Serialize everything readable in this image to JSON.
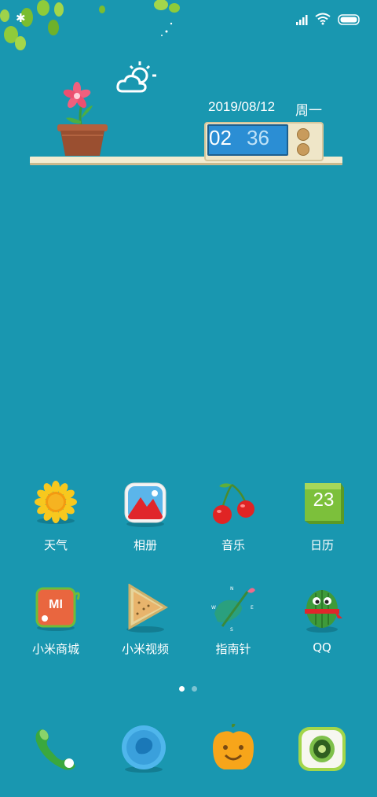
{
  "widget": {
    "date": "2019/08/12",
    "weekday": "周一",
    "clock_hour": "02",
    "clock_minute": "36"
  },
  "apps": [
    {
      "label": "天气",
      "icon": "sunflower-icon"
    },
    {
      "label": "相册",
      "icon": "gallery-icon"
    },
    {
      "label": "音乐",
      "icon": "cherry-icon"
    },
    {
      "label": "日历",
      "icon": "calendar-icon",
      "badge_text": "23"
    },
    {
      "label": "小米商城",
      "icon": "mi-store-icon",
      "badge_text": "MI"
    },
    {
      "label": "小米视频",
      "icon": "video-icon"
    },
    {
      "label": "指南针",
      "icon": "compass-icon"
    },
    {
      "label": "QQ",
      "icon": "qq-icon"
    }
  ],
  "dock": [
    {
      "icon": "phone-icon"
    },
    {
      "icon": "messages-icon"
    },
    {
      "icon": "browser-icon"
    },
    {
      "icon": "camera-icon"
    }
  ],
  "pages": {
    "count": 2,
    "active": 1
  },
  "colors": {
    "background": "#1997b0",
    "shelf": "#f3ecd0",
    "clock_screen": "#2b8ed4"
  }
}
